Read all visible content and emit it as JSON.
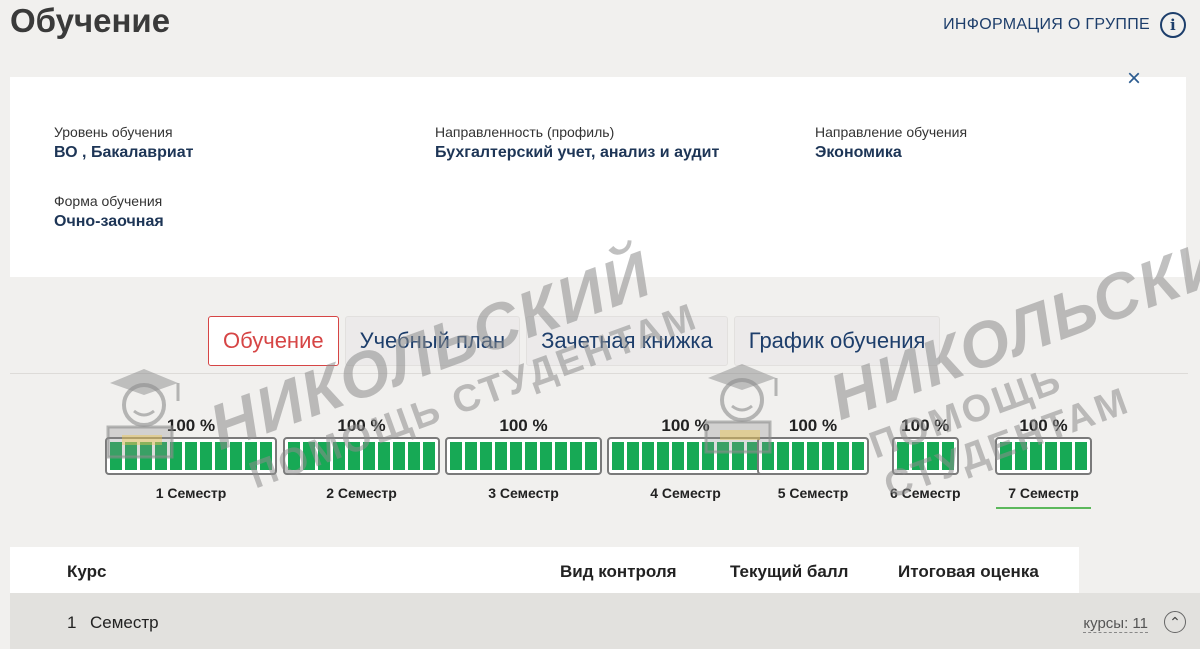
{
  "header": {
    "title": "Обучение",
    "group_info_label": "ИНФОРМАЦИЯ О ГРУППЕ",
    "info_icon": "info-circle-icon"
  },
  "info": {
    "close_icon": "close-icon",
    "level_label": "Уровень обучения",
    "level_value": "ВО , Бакалавриат",
    "profile_label": "Направленность (профиль)",
    "profile_value": "Бухгалтерский учет, анализ и аудит",
    "direction_label": "Направление обучения",
    "direction_value": "Экономика",
    "form_label": "Форма обучения",
    "form_value": "Очно-заочная"
  },
  "tabs": [
    {
      "label": "Обучение",
      "active": true
    },
    {
      "label": "Учебный план",
      "active": false
    },
    {
      "label": "Зачетная книжка",
      "active": false
    },
    {
      "label": "График обучения",
      "active": false
    }
  ],
  "semesters": [
    {
      "name": "1 Семестр",
      "percent": "100 %",
      "segments": 11
    },
    {
      "name": "2 Семестр",
      "percent": "100 %",
      "segments": 10
    },
    {
      "name": "3 Семестр",
      "percent": "100 %",
      "segments": 10
    },
    {
      "name": "4 Семестр",
      "percent": "100 %",
      "segments": 10
    },
    {
      "name": "5 Семестр",
      "percent": "100 %",
      "segments": 7
    },
    {
      "name": "6 Семестр",
      "percent": "100 %",
      "segments": 4
    },
    {
      "name": "7 Семестр",
      "percent": "100 %",
      "segments": 6,
      "selected": true
    }
  ],
  "table": {
    "col_course": "Курс",
    "col_control": "Вид контроля",
    "col_score": "Текущий балл",
    "col_grade": "Итоговая оценка",
    "row_number": "1",
    "row_label": "Семестр",
    "row_count": "курсы: 11",
    "row_toggle_icon": "expand-icon"
  },
  "watermark": {
    "line1": "НИКОЛЬСКИЙ",
    "line2": "ПОМОЩЬ СТУДЕНТАМ"
  },
  "colors": {
    "accent_red": "#d64545",
    "progress_green": "#17a955",
    "dark_blue": "#1d3e6b"
  }
}
